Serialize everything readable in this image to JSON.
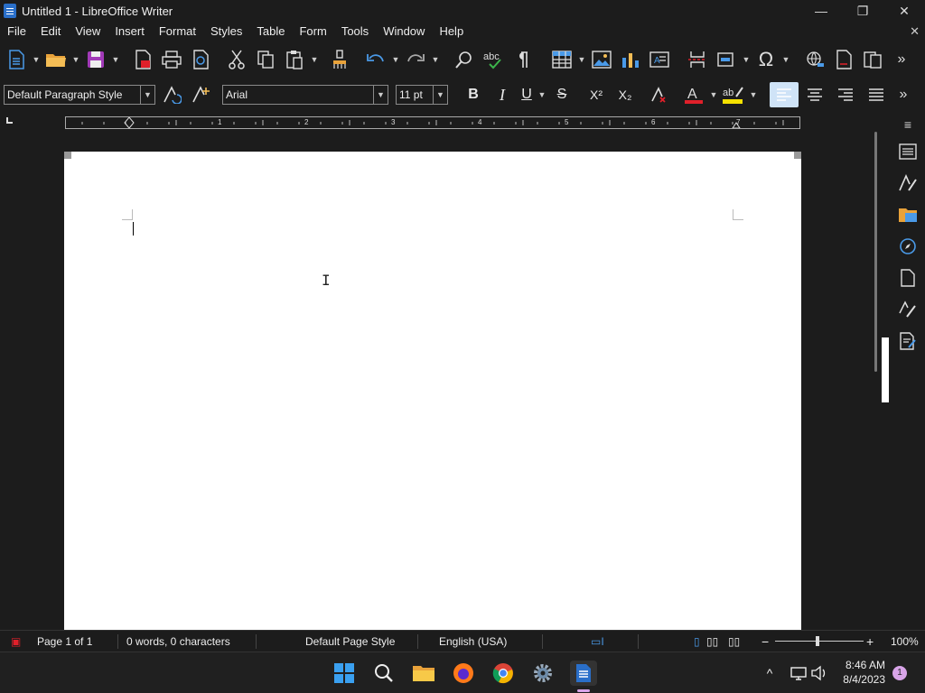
{
  "window": {
    "title": "Untitled 1 - LibreOffice Writer",
    "minimize": "—",
    "maximize": "❐",
    "close": "✕"
  },
  "menu": {
    "items": [
      "File",
      "Edit",
      "View",
      "Insert",
      "Format",
      "Styles",
      "Table",
      "Form",
      "Tools",
      "Window",
      "Help"
    ],
    "close_doc": "✕"
  },
  "formatting": {
    "paragraph_style": "Default Paragraph Style",
    "font_name": "Arial",
    "font_size": "11 pt",
    "bold": "B",
    "italic": "I",
    "underline": "U",
    "strike": "S",
    "superscript": "X²",
    "subscript": "X₂"
  },
  "status": {
    "page": "Page 1 of 1",
    "words": "0 words, 0 characters",
    "page_style": "Default Page Style",
    "language": "English (USA)",
    "zoom": "100%"
  },
  "taskbar": {
    "time": "8:46 AM",
    "date": "8/4/2023",
    "notifications": "1"
  },
  "colors": {
    "accent": "#2a6fc9",
    "font_color": "#e0202a",
    "highlight": "#f5e100",
    "active_align": "#cfe3f7"
  }
}
